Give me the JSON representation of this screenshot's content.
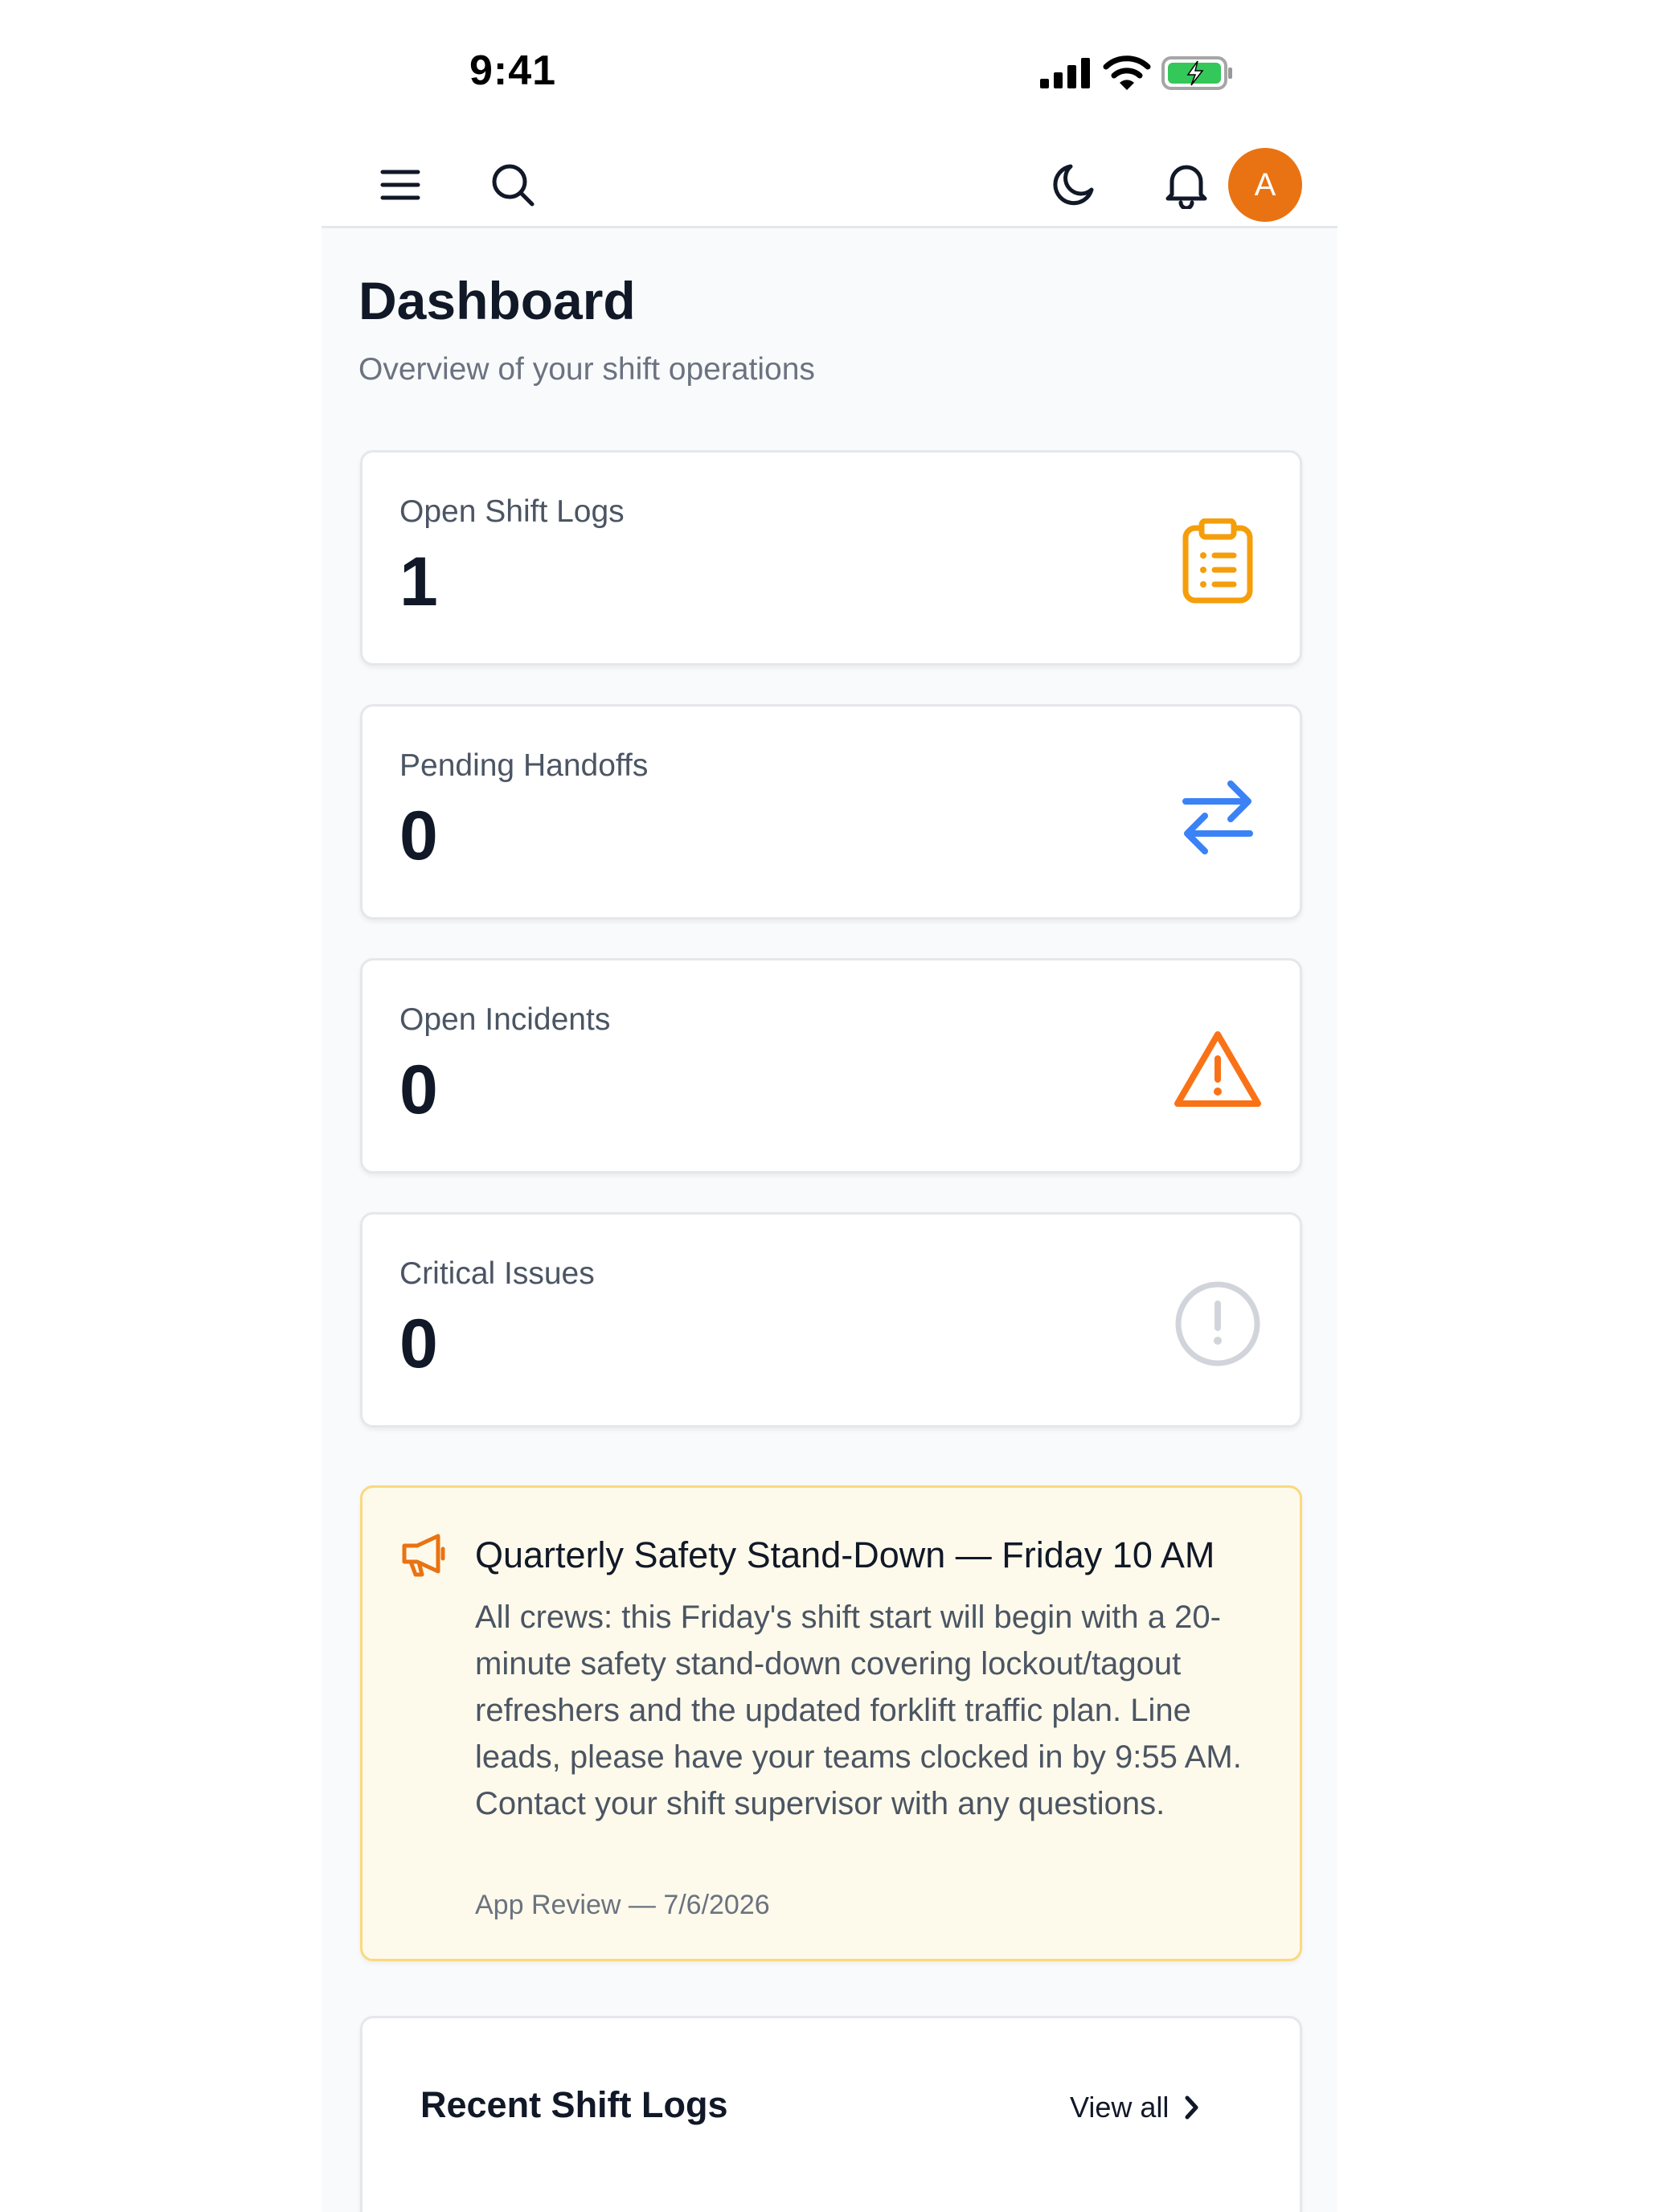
{
  "status_bar": {
    "time": "9:41",
    "icons": [
      "cellular-signal-icon",
      "wifi-icon",
      "battery-charging-icon"
    ],
    "battery_color": "#34c759"
  },
  "top_nav": {
    "icons": [
      "hamburger-menu-icon",
      "search-icon",
      "moon-icon",
      "bell-icon"
    ],
    "avatar_initial": "A",
    "avatar_color": "#e97312"
  },
  "page": {
    "title": "Dashboard",
    "subtitle": "Overview of your shift operations"
  },
  "stats": [
    {
      "label": "Open Shift Logs",
      "value": "1",
      "icon": "clipboard-list-icon",
      "icon_color": "#f59e0b"
    },
    {
      "label": "Pending Handoffs",
      "value": "0",
      "icon": "arrows-exchange-icon",
      "icon_color": "#3b82f6"
    },
    {
      "label": "Open Incidents",
      "value": "0",
      "icon": "warning-triangle-icon",
      "icon_color": "#f97316"
    },
    {
      "label": "Critical Issues",
      "value": "0",
      "icon": "alert-circle-icon",
      "icon_color": "#d1d5db"
    }
  ],
  "announcement": {
    "icon": "megaphone-icon",
    "title": "Quarterly Safety Stand-Down — Friday 10 AM",
    "body": "All crews: this Friday's shift start will begin with a 20-minute safety stand-down covering lockout/tagout refreshers and the updated forklift traffic plan. Line leads, please have your teams clocked in by 9:55 AM. Contact your shift supervisor with any questions.",
    "meta": "App Review — 7/6/2026",
    "background_color": "#fefaeb",
    "border_color": "#fad97e"
  },
  "recent_shift_logs": {
    "title": "Recent Shift Logs",
    "view_all_label": "View all"
  }
}
